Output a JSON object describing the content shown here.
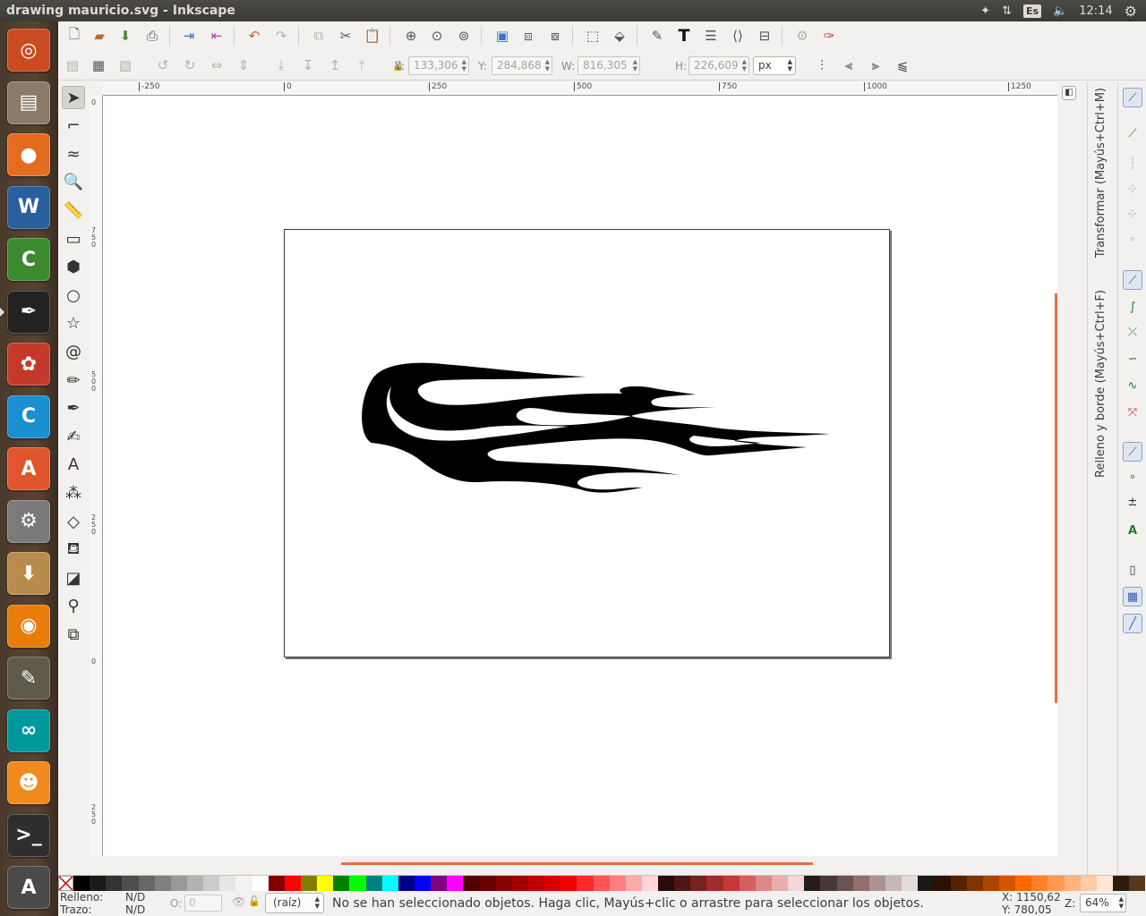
{
  "window": {
    "title": "drawing  mauricio.svg - Inkscape"
  },
  "system_tray": {
    "keyboard_layout": "Es",
    "clock": "12:14"
  },
  "launcher": {
    "apps": [
      {
        "name": "Dash",
        "glyph": "◎",
        "color": "#c84b21"
      },
      {
        "name": "Files",
        "glyph": "▤",
        "color": "#8d7b6a"
      },
      {
        "name": "Firefox",
        "glyph": "●",
        "color": "#e46c1e"
      },
      {
        "name": "LibreOffice Writer",
        "glyph": "W",
        "color": "#2a5f9e"
      },
      {
        "name": "LibreOffice Calc",
        "glyph": "C",
        "color": "#3b8a2f"
      },
      {
        "name": "Inkscape",
        "glyph": "✒",
        "color": "#222222"
      },
      {
        "name": "FreeFEM",
        "glyph": "✿",
        "color": "#c43a2a"
      },
      {
        "name": "Cura",
        "glyph": "C",
        "color": "#1a8fd1"
      },
      {
        "name": "Ubuntu Software",
        "glyph": "A",
        "color": "#e0552c"
      },
      {
        "name": "System Settings",
        "glyph": "⚙",
        "color": "#7a7a7a"
      },
      {
        "name": "Archive Manager",
        "glyph": "⬇",
        "color": "#b98b4d"
      },
      {
        "name": "Blender",
        "glyph": "◉",
        "color": "#e87d0d"
      },
      {
        "name": "GIMP",
        "glyph": "✎",
        "color": "#5f5a4c"
      },
      {
        "name": "Arduino",
        "glyph": "∞",
        "color": "#00979d"
      },
      {
        "name": "Scratch",
        "glyph": "☻",
        "color": "#f08a1f"
      },
      {
        "name": "Terminal",
        "glyph": ">_",
        "color": "#2e2e2e"
      },
      {
        "name": "Software Updater",
        "glyph": "A",
        "color": "#4a4a4a"
      }
    ]
  },
  "controls": {
    "x_label": "X:",
    "x_value": "133,306",
    "y_label": "Y:",
    "y_value": "284,868",
    "w_label": "W:",
    "w_value": "816,305",
    "h_label": "H:",
    "h_value": "226,609",
    "unit": "px"
  },
  "rulers": {
    "horizontal": [
      "-250",
      "0",
      "250",
      "500",
      "750",
      "1000",
      "1250"
    ],
    "vertical": [
      "0",
      "750",
      "500",
      "250",
      "0",
      "250"
    ]
  },
  "tools": [
    {
      "name": "selector-tool",
      "glyph": "➤",
      "selected": true
    },
    {
      "name": "node-tool",
      "glyph": "⌐"
    },
    {
      "name": "tweak-tool",
      "glyph": "≈"
    },
    {
      "name": "zoom-tool",
      "glyph": "🔍"
    },
    {
      "name": "measure-tool",
      "glyph": "📏"
    },
    {
      "name": "rectangle-tool",
      "glyph": "▭"
    },
    {
      "name": "3d-box-tool",
      "glyph": "⬢"
    },
    {
      "name": "ellipse-tool",
      "glyph": "○"
    },
    {
      "name": "star-tool",
      "glyph": "☆"
    },
    {
      "name": "spiral-tool",
      "glyph": "@"
    },
    {
      "name": "pencil-tool",
      "glyph": "✏"
    },
    {
      "name": "pen-tool",
      "glyph": "✒"
    },
    {
      "name": "calligraphy-tool",
      "glyph": "✍"
    },
    {
      "name": "text-tool",
      "glyph": "A"
    },
    {
      "name": "spray-tool",
      "glyph": "⁂"
    },
    {
      "name": "eraser-tool",
      "glyph": "◇"
    },
    {
      "name": "paint-bucket-tool",
      "glyph": "⛾"
    },
    {
      "name": "gradient-tool",
      "glyph": "◪"
    },
    {
      "name": "dropper-tool",
      "glyph": "⚲"
    },
    {
      "name": "connector-tool",
      "glyph": "⧉"
    }
  ],
  "dock": {
    "transform_tab": "Transformar (Mayús+Ctrl+M)",
    "fill_stroke_tab": "Relleno y borde (Mayús+Ctrl+F)"
  },
  "palette_colors": [
    "#000000",
    "#1a1a1a",
    "#333333",
    "#4d4d4d",
    "#666666",
    "#808080",
    "#999999",
    "#b3b3b3",
    "#cccccc",
    "#e6e6e6",
    "#f2f2f2",
    "#ffffff",
    "#800000",
    "#ff0000",
    "#808000",
    "#ffff00",
    "#008000",
    "#00ff00",
    "#008080",
    "#00ffff",
    "#000080",
    "#0000ff",
    "#800080",
    "#ff00ff",
    "#500000",
    "#6b0000",
    "#870000",
    "#a20000",
    "#be0000",
    "#da0000",
    "#f50000",
    "#ff2a2a",
    "#ff5555",
    "#ff8080",
    "#ffaaaa",
    "#ffd5d5",
    "#280b0b",
    "#501616",
    "#782121",
    "#a02c2c",
    "#c83737",
    "#d35f5f",
    "#de8787",
    "#e9afaf",
    "#f4d7d7",
    "#241c1c",
    "#483737",
    "#6c5353",
    "#916f6f",
    "#ac9393",
    "#c8b7b7",
    "#e3dbdb",
    "#1c1717",
    "#2b1100",
    "#552200",
    "#803300",
    "#aa4400",
    "#d45500",
    "#ff6600",
    "#ff7f2a",
    "#ff9955",
    "#ffb380",
    "#ffccaa",
    "#ffe6d5",
    "#2b1d0e",
    "#553a1b"
  ],
  "status": {
    "fill_label": "Relleno:",
    "fill_value": "N/D",
    "stroke_label": "Trazo:",
    "stroke_value": "N/D",
    "opacity_label": "O:",
    "opacity_value": "0",
    "layer": "(raíz)",
    "message": "No se han seleccionado objetos. Haga clic, Mayús+clic o arrastre para seleccionar los objetos.",
    "x_coord": "X: 1150,62",
    "y_coord": "Y:   780,05",
    "zoom_label": "Z:",
    "zoom": "64%"
  }
}
